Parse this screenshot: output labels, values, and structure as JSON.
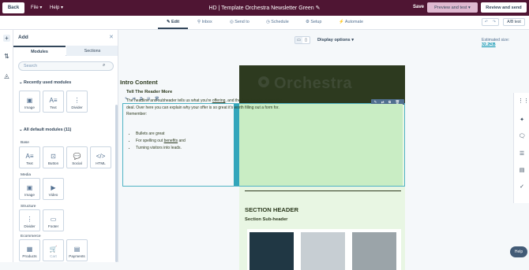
{
  "topbar": {
    "back_label": "Back",
    "menu_file": "File",
    "menu_help": "Help",
    "title": "HD | Template Orchestra Newsletter Green",
    "save_label": "Save",
    "preview_label": "Preview and test",
    "review_label": "Review and send",
    "ab_test_label": "A/B test"
  },
  "tabs": [
    {
      "label": "Edit"
    },
    {
      "label": "Inbox"
    },
    {
      "label": "Send to"
    },
    {
      "label": "Schedule"
    },
    {
      "label": "Setup"
    },
    {
      "label": "Automate"
    }
  ],
  "panel": {
    "title": "Add",
    "tab_modules": "Modules",
    "tab_sections": "Sections",
    "search_placeholder": "Search",
    "recent_heading": "Recently used modules",
    "recent": [
      {
        "label": "Image"
      },
      {
        "label": "Text"
      },
      {
        "label": "Divider"
      }
    ],
    "all_heading": "All default modules (11)",
    "groups": [
      {
        "name": "Base",
        "items": [
          {
            "label": "Text"
          },
          {
            "label": "Button"
          },
          {
            "label": "Social"
          },
          {
            "label": "HTML"
          }
        ]
      },
      {
        "name": "Media",
        "items": [
          {
            "label": "Image"
          },
          {
            "label": "Video"
          }
        ]
      },
      {
        "name": "Structure",
        "items": [
          {
            "label": "Divider"
          },
          {
            "label": "Footer"
          }
        ]
      },
      {
        "name": "Ecommerce",
        "items": [
          {
            "label": "Products"
          },
          {
            "label": "Cart"
          },
          {
            "label": "Payments"
          }
        ]
      }
    ],
    "beta_badge": "Beta"
  },
  "canvas": {
    "display_options": "Display options",
    "estimated_size_label": "Estimated size:",
    "estimated_size_value": "32.2KB"
  },
  "email": {
    "logo_text": "Orchestra",
    "intro_heading": "Intro Content",
    "intro_subheading": "Tell The Reader More",
    "intro_p1": "The headline and subheader tells us what you're",
    "intro_link1": "offering",
    "intro_p2": ", and the form header closes the deal. Over here you can explain why your offer is so great it's worth filling out a form for.",
    "intro_p3": "Remember:",
    "bullet1": "Bullets are great",
    "bullet2_pre": "For spelling out ",
    "bullet2_link": "benefits",
    "bullet2_post": " and",
    "bullet3": "Turning visitors into leads.",
    "section_heading": "SECTION HEADER",
    "section_sub": "Section Sub-header"
  },
  "help_label": "Help",
  "colors": {
    "topbar": "#4f1533",
    "email_bg": "#e8f6e3",
    "selection": "#33a6bb"
  }
}
